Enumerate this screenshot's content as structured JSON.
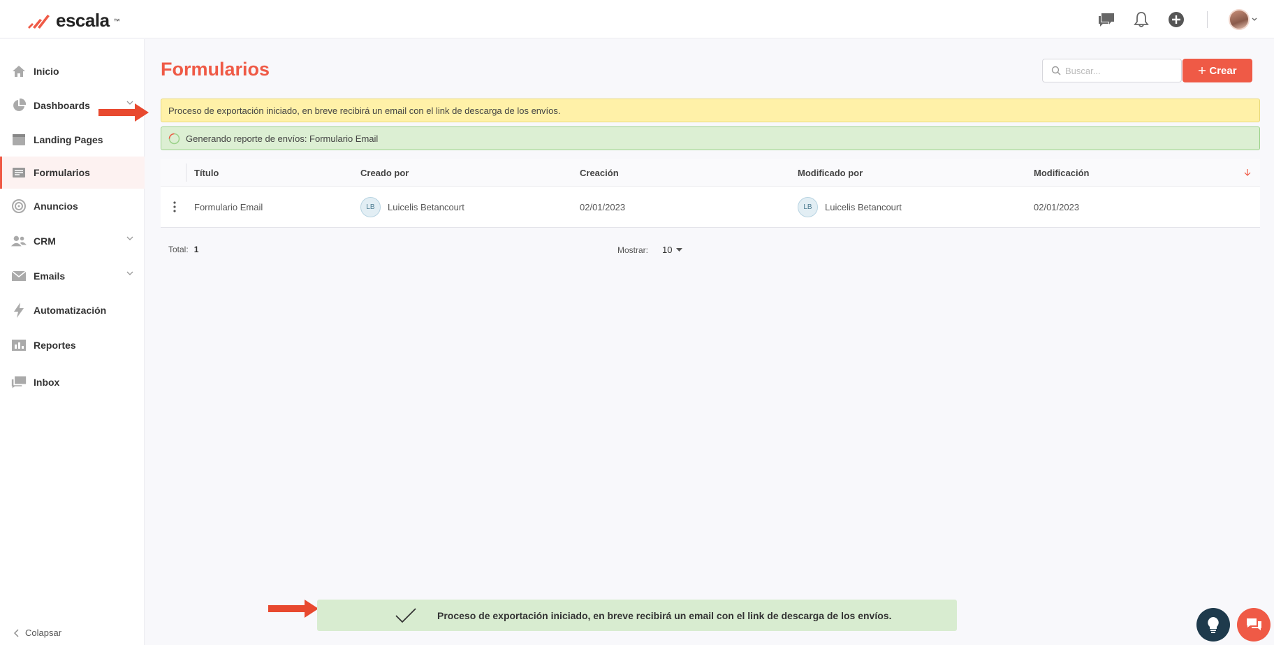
{
  "brand": {
    "name": "escala",
    "tm": "™",
    "accent": "#ef5a46"
  },
  "topbar": {
    "icons": [
      "chat-bubbles-icon",
      "bell-icon",
      "plus-circle-icon",
      "avatar"
    ]
  },
  "sidebar": {
    "items": [
      {
        "label": "Inicio",
        "icon": "home-icon"
      },
      {
        "label": "Dashboards",
        "icon": "pie-chart-icon",
        "has_chevron": true
      },
      {
        "label": "Landing Pages",
        "icon": "landing-page-icon"
      },
      {
        "label": "Formularios",
        "icon": "form-icon",
        "active": true
      },
      {
        "label": "Anuncios",
        "icon": "target-icon"
      },
      {
        "label": "CRM",
        "icon": "users-icon",
        "has_chevron": true
      },
      {
        "label": "Emails",
        "icon": "envelope-icon",
        "has_chevron": true
      },
      {
        "label": "Automatización",
        "icon": "lightning-icon"
      },
      {
        "label": "Reportes",
        "icon": "bar-chart-icon"
      },
      {
        "label": "Inbox",
        "icon": "inbox-icon"
      }
    ],
    "collapse_label": "Colapsar"
  },
  "page": {
    "title": "Formularios",
    "search_placeholder": "Buscar...",
    "create_label": "Crear"
  },
  "alerts": {
    "yellow": "Proceso de exportación iniciado, en breve recibirá un email con el link de descarga de los envíos.",
    "green": "Generando reporte de envíos: Formulario Email"
  },
  "table": {
    "headers": [
      "Título",
      "Creado por",
      "Creación",
      "Modificado por",
      "Modificación"
    ],
    "rows": [
      {
        "title": "Formulario Email",
        "created_by_initials": "LB",
        "created_by": "Luicelis Betancourt",
        "created": "02/01/2023",
        "modified_by_initials": "LB",
        "modified_by": "Luicelis Betancourt",
        "modified": "02/01/2023"
      }
    ]
  },
  "footer": {
    "total_label": "Total:",
    "total_value": "1",
    "show_label": "Mostrar:",
    "show_value": "10"
  },
  "toast": {
    "message": "Proceso de exportación iniciado, en breve recibirá un email con el link de descarga de los envíos."
  }
}
